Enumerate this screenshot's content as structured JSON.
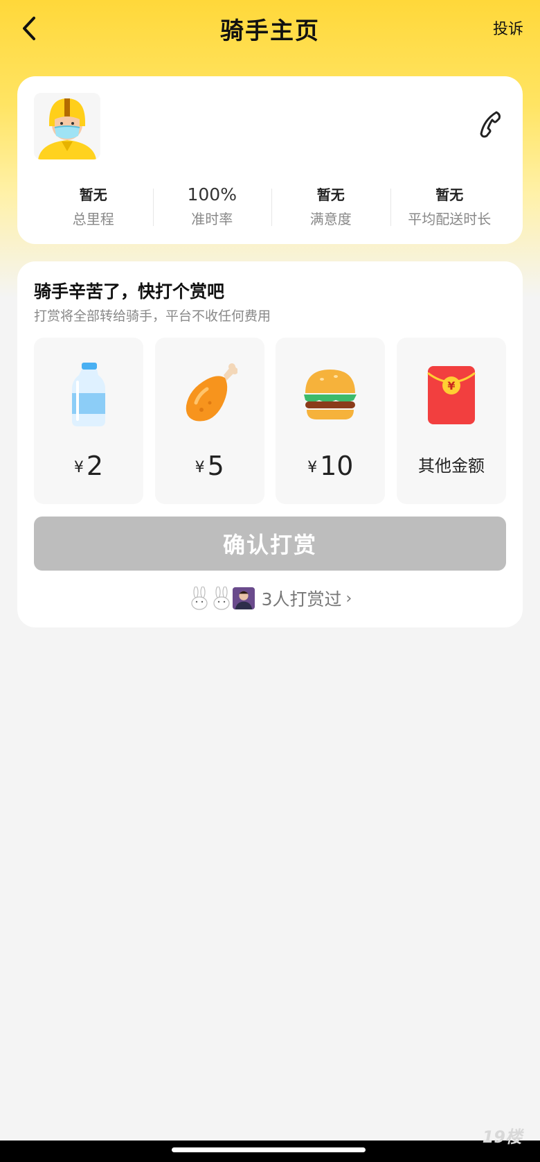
{
  "header": {
    "title": "骑手主页",
    "complain_label": "投诉"
  },
  "rider": {
    "stats": [
      {
        "value": "暂无",
        "label": "总里程"
      },
      {
        "value": "100%",
        "label": "准时率"
      },
      {
        "value": "暂无",
        "label": "满意度"
      },
      {
        "value": "暂无",
        "label": "平均配送时长"
      }
    ]
  },
  "tip": {
    "title": "骑手辛苦了，快打个赏吧",
    "subtitle": "打赏将全部转给骑手，平台不收任何费用",
    "options": [
      {
        "icon": "water-bottle-icon",
        "currency": "¥",
        "amount": "2"
      },
      {
        "icon": "chicken-leg-icon",
        "currency": "¥",
        "amount": "5"
      },
      {
        "icon": "burger-icon",
        "currency": "¥",
        "amount": "10"
      },
      {
        "icon": "red-envelope-icon",
        "label": "其他金额"
      }
    ],
    "confirm_label": "确认打赏",
    "confirm_color": "#bdbdbd",
    "tippers_text": "3人打赏过",
    "tippers_arrow": "›"
  },
  "watermark": "19楼",
  "colors": {
    "accent_yellow": "#ffd83a",
    "page_bg": "#f4f4f4"
  }
}
